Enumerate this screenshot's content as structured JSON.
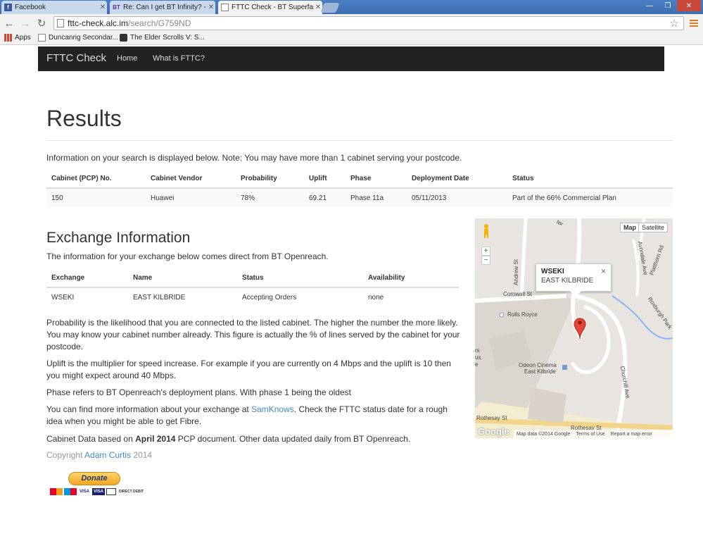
{
  "browser": {
    "tabs": [
      {
        "title": "Facebook",
        "favicon": "facebook-icon",
        "active": false
      },
      {
        "title": "Re: Can I get BT Infinity? -",
        "favicon": "bt-icon",
        "active": false
      },
      {
        "title": "FTTC Check - BT Superfas",
        "favicon": "page-icon",
        "active": true
      }
    ],
    "url_host": "fttc-check.alc.im",
    "url_path": "/search/G759ND",
    "bookmarks": [
      {
        "label": "Apps",
        "icon": "apps-icon"
      },
      {
        "label": "Duncanrig Secondar...",
        "icon": "page-icon"
      },
      {
        "label": "The Elder Scrolls V: S...",
        "icon": "game-icon"
      }
    ]
  },
  "navbar": {
    "brand": "FTTC Check",
    "links": [
      "Home",
      "What is FTTC?"
    ]
  },
  "results": {
    "title": "Results",
    "intro": "Information on your search is displayed below. Note: You may have more than 1 cabinet serving your postcode.",
    "headers": [
      "Cabinet (PCP) No.",
      "Cabinet Vendor",
      "Probability",
      "Uplift",
      "Phase",
      "Deployment Date",
      "Status"
    ],
    "rows": [
      [
        "150",
        "Huawei",
        "78%",
        "69.21",
        "Phase 11a",
        "05/11/2013",
        "Part of the 66% Commercial Plan"
      ]
    ]
  },
  "exchange": {
    "title": "Exchange Information",
    "subtitle": "The information for your exchange below comes direct from BT Openreach.",
    "headers": [
      "Exchange",
      "Name",
      "Status",
      "Availability"
    ],
    "rows": [
      [
        "WSEKI",
        "EAST KILBRIDE",
        "Accepting Orders",
        "none"
      ]
    ]
  },
  "notes": {
    "probability": "Probability is the likelihood that you are connected to the listed cabinet. The higher the number the more likely. You may know your cabinet number already. This figure is actually the % of lines served by the cabinet for your postcode.",
    "uplift": "Uplift is the multiplier for speed increase. For example if you are currently on 4 Mbps and the uplift is 10 then you might expect around 40 Mbps.",
    "phase": "Phase refers to BT Openreach's deployment plans. With phase 1 being the oldest",
    "more_pre": "You can find more information about your exchange at ",
    "more_link": "SamKnows",
    "more_post": ". Check the FTTC status date for a rough idea when you might be able to get Fibre.",
    "data_pre": "Cabinet Data based on ",
    "data_bold": "April 2014",
    "data_post": " PCP document. Other data updated daily from BT Openreach.",
    "copy_pre": "Copyright ",
    "copy_link": "Adam Curtis",
    "copy_post": " 2014"
  },
  "donate": {
    "label": "Donate",
    "cards": [
      "VISA",
      "VISA",
      "DIRECT DEBIT"
    ]
  },
  "map": {
    "buttons": [
      "Map",
      "Satellite"
    ],
    "zoom_in": "+",
    "zoom_out": "−",
    "info_name": "WSEKI",
    "info_sub": "EAST KILBRIDE",
    "info_close": "×",
    "labels": {
      "cornwall": "Cornwall St",
      "andrew": "Andrew St",
      "rolls": "Rolls Royce",
      "odeon1": "Odeon Cinema",
      "odeon2": "East Kilbride",
      "rothesay1": "Rothesay St",
      "rothesay2": "Rothesay St",
      "churchill": "Churchill Ave",
      "avondale": "Avondale Ave",
      "roxburgh": "Roxburgh Park",
      "platthorn": "Platthorn Rd",
      "ter": "ter",
      "rs": "rs",
      "us": "us",
      "e": "e"
    },
    "footer": [
      "Map data ©2014 Google",
      "Terms of Use",
      "Report a map error"
    ],
    "google": "Google"
  }
}
